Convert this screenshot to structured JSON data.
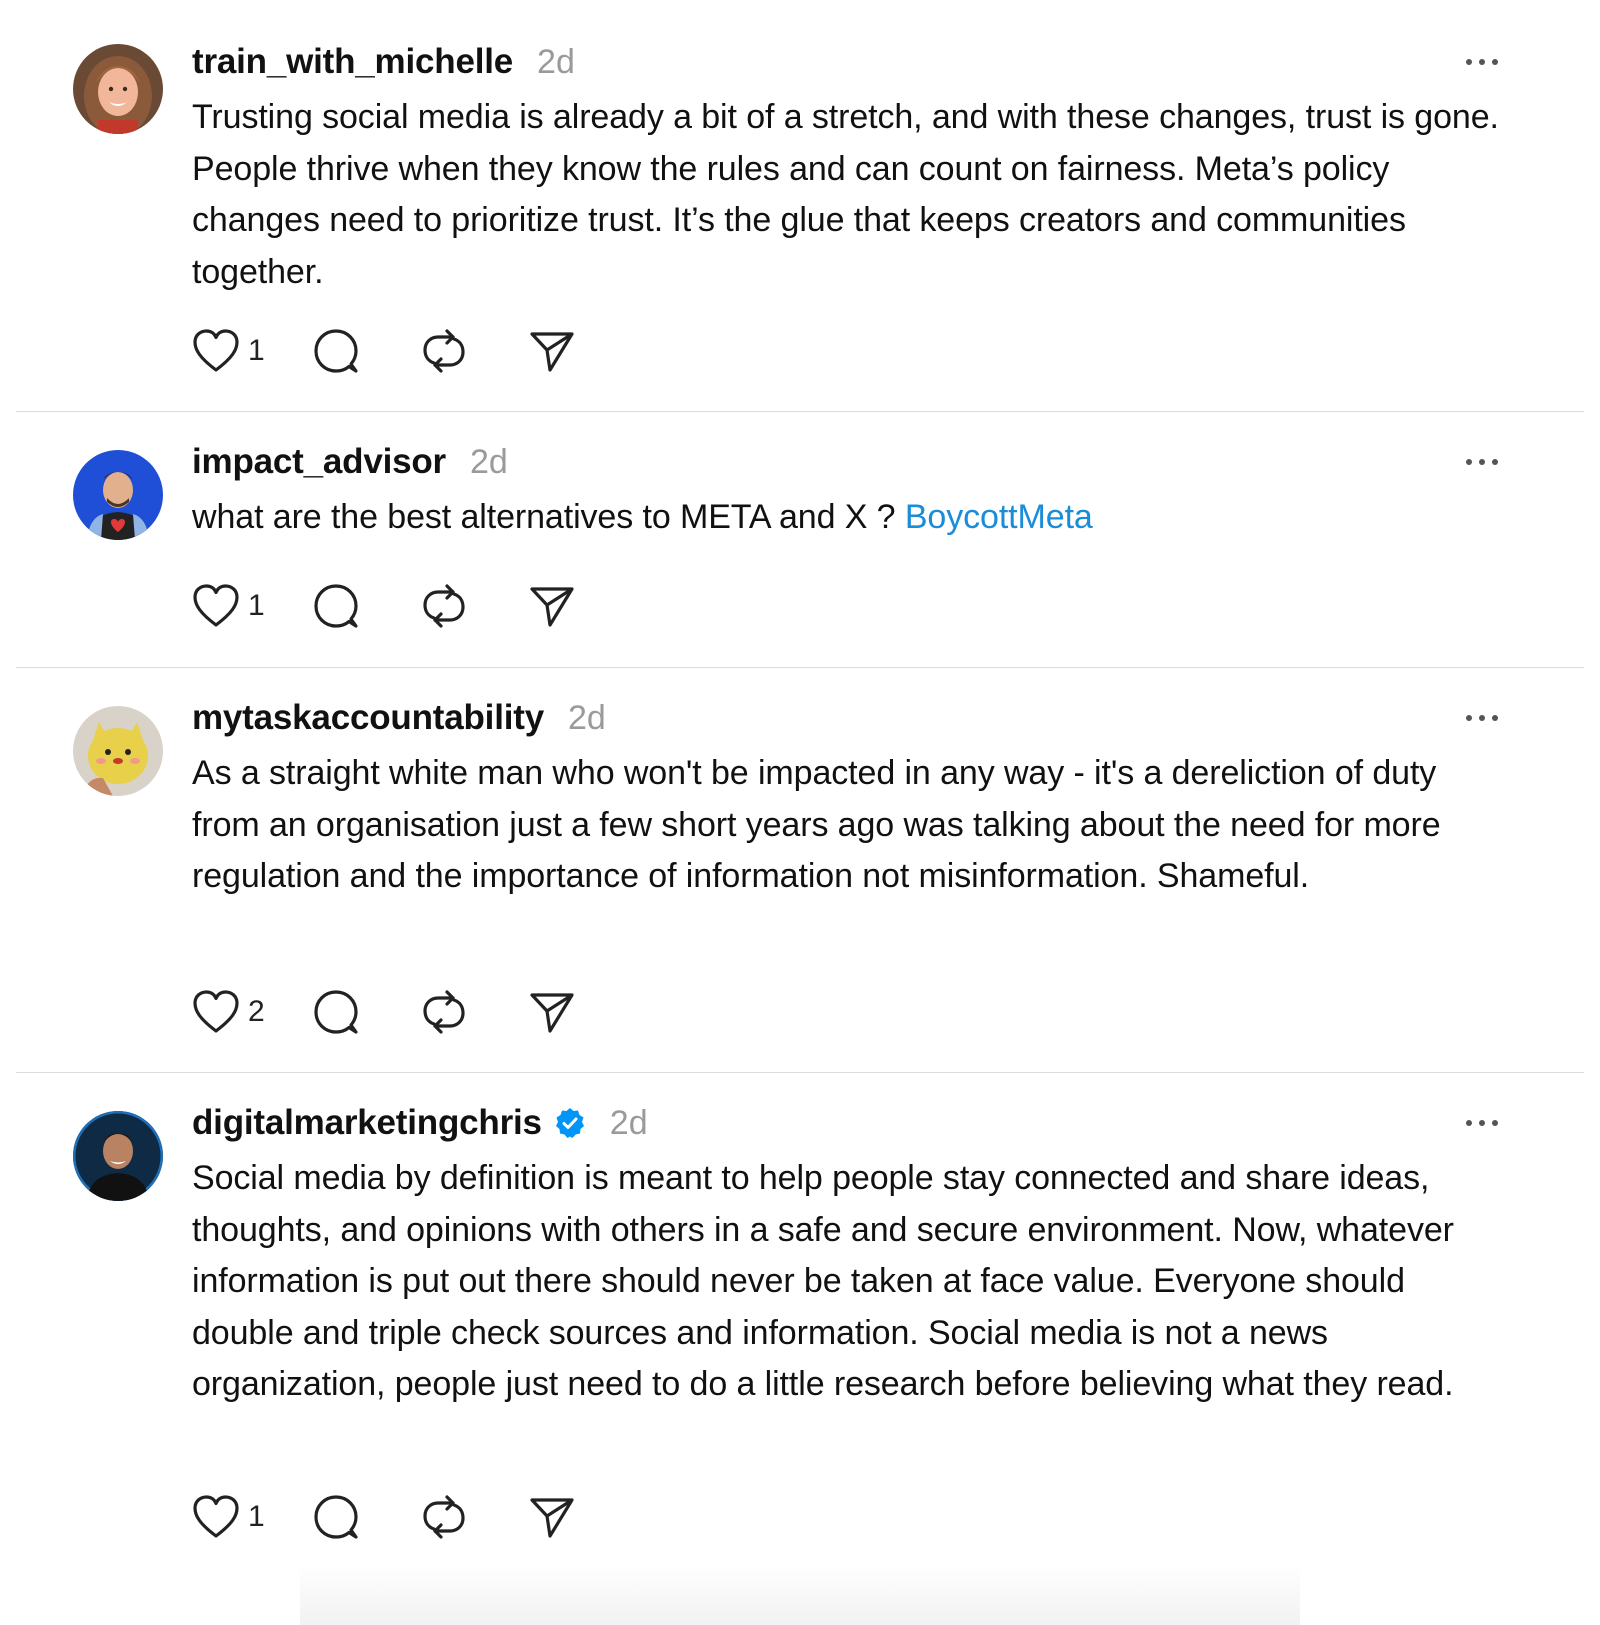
{
  "posts": [
    {
      "username": "train_with_michelle",
      "verified": false,
      "time": "2d",
      "text": "Trusting social media is already a bit of a stretch, and with these changes, trust is gone. People thrive when they know the rules and can count on fairness. Meta’s policy changes need to prioritize trust. It’s the glue that keeps creators and communities together.",
      "hashtag": "",
      "likes": "1",
      "avatar_icon": "woman-portrait"
    },
    {
      "username": "impact_advisor",
      "verified": false,
      "time": "2d",
      "text": "what are the best alternatives to META and X ? ",
      "hashtag": "BoycottMeta",
      "likes": "1",
      "avatar_icon": "man-portrait-blue-background"
    },
    {
      "username": "mytaskaccountability",
      "verified": false,
      "time": "2d",
      "text": "As a straight white man who won't be impacted in any way - it's a dereliction of duty from an organisation just a few short years ago was talking about the need for more regulation and the importance of information not misinformation. Shameful.",
      "hashtag": "",
      "likes": "2",
      "avatar_icon": "yellow-toy-character"
    },
    {
      "username": "digitalmarketingchris",
      "verified": true,
      "time": "2d",
      "text": "Social media by definition is meant to help people stay connected and share ideas, thoughts, and opinions with others in a safe and secure environment. Now, whatever information is put out there should never be taken at face value. Everyone should double and triple check sources and information. Social media is not a news organization, people just need to do a little research before believing what they read.",
      "hashtag": "",
      "likes": "1",
      "avatar_icon": "man-portrait-dark-background"
    }
  ],
  "colors": {
    "text": "#111111",
    "timestamp": "#9a9a9a",
    "hashtag": "#1a8cd8",
    "divider": "#dcdcdc",
    "verified": "#0095f6"
  },
  "icons": {
    "like": "heart-icon",
    "reply": "speech-bubble-icon",
    "repost": "repost-arrows-icon",
    "share": "paper-plane-icon",
    "more": "more-dots-icon",
    "verified": "verified-badge-icon"
  }
}
